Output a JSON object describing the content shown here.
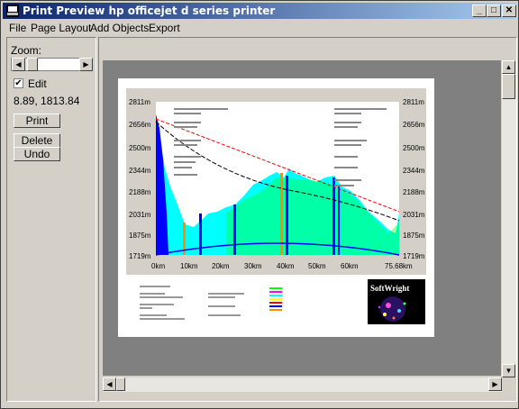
{
  "window": {
    "title": "Print Preview hp officejet d series printer",
    "min_label": "_",
    "max_label": "□",
    "close_label": "✕"
  },
  "menu": [
    "File",
    "Page Layout",
    "Add Objects",
    "Export"
  ],
  "left": {
    "zoom_label": "Zoom:",
    "edit_label": "Edit",
    "edit_checked": true,
    "coords": "8.89, 1813.84",
    "print_label": "Print",
    "delete_label": "Delete",
    "undo_label": "Undo"
  },
  "profile": {
    "y_ticks": [
      "2811m",
      "2656m",
      "2500m",
      "2344m",
      "2188m",
      "2031m",
      "1875m",
      "1719m"
    ],
    "x_ticks": [
      "0km",
      "10km",
      "20km",
      "30km",
      "40km",
      "50km",
      "60km",
      "75.68km"
    ],
    "logo_text": "SoftWright"
  },
  "colors": {
    "titlebar_start": "#0a246a",
    "titlebar_end": "#a6caf0",
    "terrain_fill": "#00ffff",
    "terrain_blue": "#0000ff",
    "terrain_green": "#00ff00",
    "sightline_red": "#ff0000",
    "sightline_black": "#000000"
  }
}
